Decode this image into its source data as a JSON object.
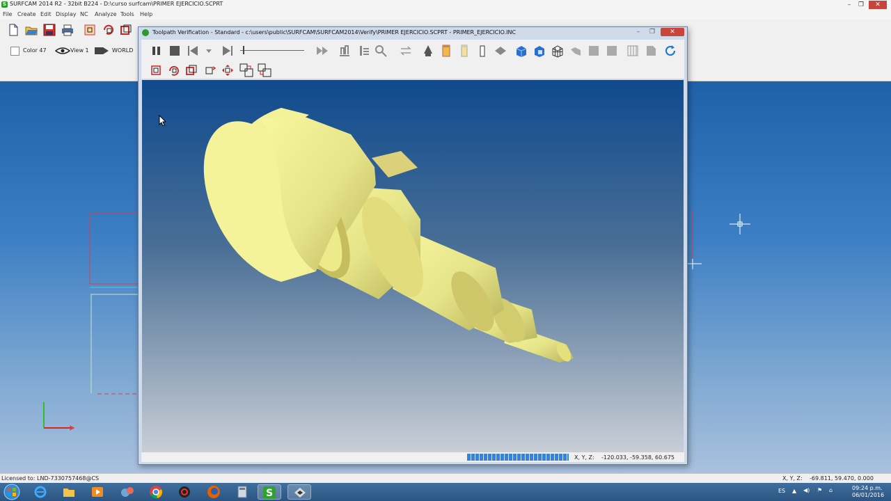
{
  "app": {
    "title": "SURFCAM 2014 R2 - 32bit B224 - D:\\curso surfcam\\PRIMER EJERCICIO.SCPRT",
    "window_controls": [
      "–",
      "❐",
      "✕"
    ]
  },
  "menu": [
    "File",
    "Create",
    "Edit",
    "Display",
    "NC",
    "Analyze",
    "Tools",
    "Help"
  ],
  "toolbar": {
    "color_label": "Color 47",
    "view_label": "View 1",
    "world_label": "WORLD"
  },
  "dialog": {
    "title": "Toolpath Verification - Standard - c:\\users\\public\\SURFCAM\\SURFCAM2014\\Verify\\PRIMER EJERCICIO.SCPRT - PRIMER_EJERCICIO.INC",
    "controls": [
      "–",
      "❐",
      "✕"
    ],
    "status": {
      "xyz_label": "X, Y, Z:",
      "xyz_value": "-120.033, -59.358, 60.675",
      "progress": 1.0
    }
  },
  "statusbar": {
    "license": "Licensed to: LND-7330757468@CS",
    "xyz_label": "X, Y, Z:",
    "xyz_value": "-69.811, 59.470, 0.000"
  },
  "taskbar": {
    "language": "ES",
    "time": "09:24 p.m.",
    "date": "06/01/2016"
  },
  "colors": {
    "part": "#ecec8a",
    "accent_blue": "#2f86e0",
    "taskbar": "#2b5582"
  }
}
